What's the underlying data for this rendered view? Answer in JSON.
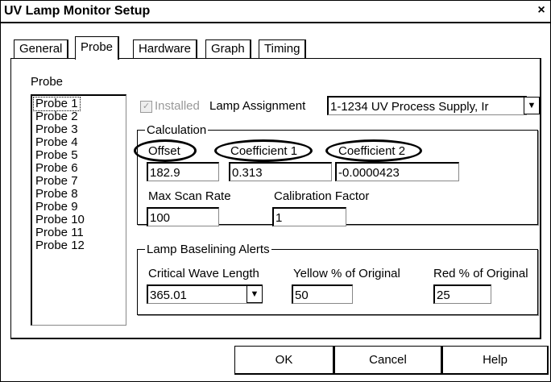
{
  "window": {
    "title": "UV Lamp Monitor Setup",
    "close_glyph": "×"
  },
  "tabs": [
    {
      "label": "General",
      "active": false
    },
    {
      "label": "Probe",
      "active": true
    },
    {
      "label": "Hardware",
      "active": false
    },
    {
      "label": "Graph",
      "active": false
    },
    {
      "label": "Timing",
      "active": false
    }
  ],
  "probe_list": {
    "label": "Probe",
    "items": [
      "Probe 1",
      "Probe 2",
      "Probe 3",
      "Probe 4",
      "Probe 5",
      "Probe 6",
      "Probe 7",
      "Probe 8",
      "Probe 9",
      "Probe 10",
      "Probe 11",
      "Probe 12"
    ],
    "selected": "Probe 1"
  },
  "installed": {
    "label": "Installed",
    "checked": true,
    "disabled": true
  },
  "lamp_assignment": {
    "label": "Lamp Assignment",
    "value": "1-1234    UV Process Supply, Ir"
  },
  "calculation": {
    "legend": "Calculation",
    "offset_label": "Offset",
    "offset_value": "182.9",
    "coef1_label": "Coefficient 1",
    "coef1_value": "0.313",
    "coef2_label": "Coefficient 2",
    "coef2_value": "-0.0000423",
    "max_scan_label": "Max Scan Rate",
    "max_scan_value": "100",
    "cal_factor_label": "Calibration Factor",
    "cal_factor_value": "1"
  },
  "alerts": {
    "legend": "Lamp Baselining Alerts",
    "cwl_label": "Critical Wave Length",
    "cwl_value": "365.01",
    "yellow_label": "Yellow % of Original",
    "yellow_value": "50",
    "red_label": "Red % of Original",
    "red_value": "25"
  },
  "buttons": {
    "ok": "OK",
    "cancel": "Cancel",
    "help": "Help"
  },
  "icons": {
    "dropdown": "chevron-down-icon",
    "check": "checkmark-icon",
    "close": "close-icon"
  }
}
